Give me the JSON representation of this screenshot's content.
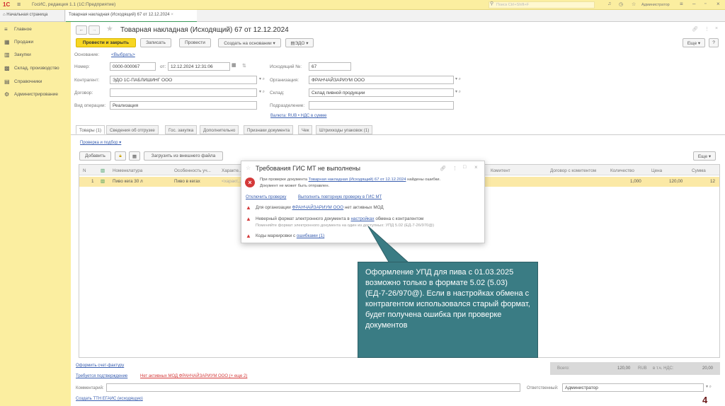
{
  "app": {
    "logo": "1С",
    "title": "ГосИС, редакция 1.1 (1С:Предприятие)",
    "search_placeholder": "Поиск Ctrl+Shift+F",
    "user": "Администратор"
  },
  "tabs": {
    "home": "Начальная страница",
    "doc": "Товарная накладная (Исходящий) 67 от 12.12.2024"
  },
  "sidebar": {
    "items": [
      {
        "label": "Главное",
        "icon": "≡"
      },
      {
        "label": "Продажи",
        "icon": "▦"
      },
      {
        "label": "Закупки",
        "icon": "▥"
      },
      {
        "label": "Склад, производство",
        "icon": "▩"
      },
      {
        "label": "Справочники",
        "icon": "▤"
      },
      {
        "label": "Администрирование",
        "icon": "⚙"
      }
    ]
  },
  "form": {
    "title": "Товарная накладная (Исходящий) 67 от 12.12.2024",
    "buttons": {
      "post_close": "Провести и закрыть",
      "save": "Записать",
      "post": "Провести",
      "create_based": "Создать на основании ▾",
      "edo": "ЭДО ▾",
      "more": "Еще ▾",
      "help": "?"
    },
    "basis_label": "Основание:",
    "basis_value": "<Выбрать>",
    "number_label": "Номер:",
    "number": "0000-000067",
    "from_label": "от:",
    "date": "12.12.2024 12:31:06",
    "outgoing_label": "Исходящий №:",
    "outgoing": "67",
    "counterparty_label": "Контрагент:",
    "counterparty": "ЭДО 1С-ПАБЛИШИНГ ООО",
    "org_label": "Организация:",
    "org": "ФРАНЧАЙЗАРИУМ ООО",
    "contract_label": "Договор:",
    "contract": "",
    "warehouse_label": "Склад:",
    "warehouse": "Склад пивной продукции",
    "operation_label": "Вид операции:",
    "operation": "Реализация",
    "division_label": "Подразделение:",
    "division": "",
    "currency_link": "Валюта: RUB • НДС в сумме"
  },
  "doc_tabs": [
    "Товары (1)",
    "Сведения об отгрузке",
    "Гос. закупка",
    "Дополнительно",
    "Признаки документа",
    "Чек",
    "Штрихкоды упаковок (1)"
  ],
  "goods": {
    "check_link": "Проверка и подбор ▾",
    "add": "Добавить",
    "load": "Загрузить из внешнего файла",
    "more": "Еще ▾",
    "columns": [
      "N",
      "Номенклатура",
      "Особенность уч...",
      "Характе...",
      "Комитент",
      "Договор с комитентом",
      "Количество",
      "Цена",
      "Сумма"
    ],
    "rows": [
      {
        "n": "1",
        "name": "Пиво кега 30 л",
        "feature": "Пиво в кегах",
        "char": "<характ...",
        "qty": "1,000",
        "price": "120,00",
        "sum": "12"
      }
    ]
  },
  "dialog": {
    "title": "Требования ГИС МТ не выполнены",
    "msg_pre": "При проверке документа",
    "msg_link": "Товарная накладная (Исходящий) 67 от 12.12.2024",
    "msg_post": "найдены ошибки.",
    "msg_line2": "Документ не может быть отправлен.",
    "disable_check": "Отключить проверку",
    "recheck": "Выполнить повторную проверку в ГИС МТ",
    "err1_pre": "Для организации",
    "err1_link": "ФРАНЧАЙЗАРИУМ ООО",
    "err1_post": "нет активных МОД",
    "err2_pre": "Неверный формат электронного документа в",
    "err2_link": "настройках",
    "err2_post": "обмена с контрагентом",
    "err2_hint": "Поменяйте формат электронного документа на один из доступных: УПД 5.02 (ЕД-7-26/970@)",
    "err3_pre": "Коды маркировки с",
    "err3_link": "ошибками (1)"
  },
  "callout": "Оформление УПД для пива с 01.03.2025 возможно только в формате 5.02 (5.03) (ЕД-7-26/970@). Если в настройках обмена с контрагентом использовался старый формат, будет получена ошибка при проверке документов",
  "footer": {
    "invoice_link": "Оформить счет-фактуру",
    "confirm_link": "Требуется подтверждение",
    "error_link": "Нет активных МОД ФРАНЧАЙЗАРИУМ ООО (+ еще 2)",
    "total_label": "Всего:",
    "total": "120,00",
    "currency": "RUB",
    "vat_label": "в т.ч. НДС:",
    "vat": "20,00",
    "comment_label": "Комментарий:",
    "responsible_label": "Ответственный:",
    "responsible": "Администратор",
    "egais_link": "Создать ТТН ЕГАИС (исходящую)"
  },
  "page_number": "4"
}
